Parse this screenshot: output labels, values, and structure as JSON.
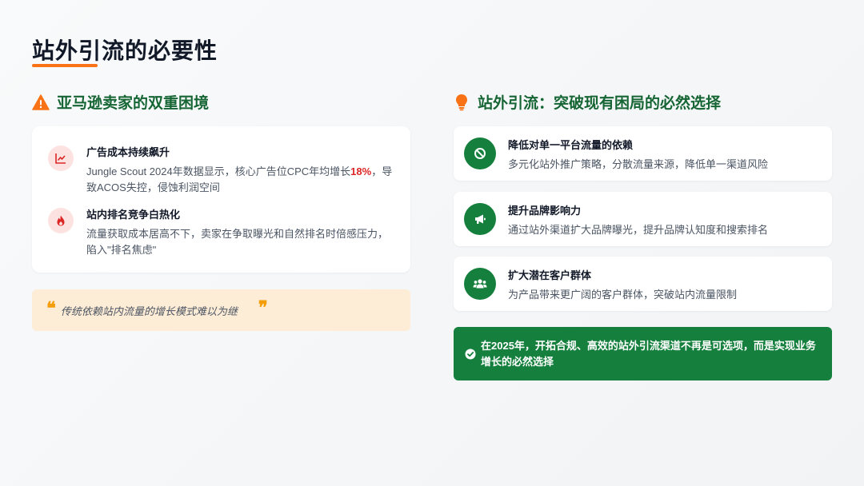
{
  "page": {
    "title": "站外引流的必要性"
  },
  "left": {
    "heading": "亚马逊卖家的双重困境",
    "heading_icon": "warning-icon",
    "items": [
      {
        "icon": "trend-chart-icon",
        "title": "广告成本持续飙升",
        "desc_before": "Jungle Scout 2024年数据显示，核心广告位CPC年均增长",
        "desc_highlight": "18%",
        "desc_after": "，导致ACOS失控，侵蚀利润空间"
      },
      {
        "icon": "fire-icon",
        "title": "站内排名竞争白热化",
        "desc": "流量获取成本居高不下，卖家在争取曝光和自然排名时倍感压力，陷入\"排名焦虑\""
      }
    ],
    "quote": {
      "open_mark": "❝",
      "text": "传统依赖站内流量的增长模式难以为继",
      "close_mark": "❞"
    }
  },
  "right": {
    "heading": "站外引流：突破现有困局的必然选择",
    "heading_icon": "lightbulb-icon",
    "items": [
      {
        "icon": "ban-icon",
        "title": "降低对单一平台流量的依赖",
        "desc": "多元化站外推广策略，分散流量来源，降低单一渠道风险"
      },
      {
        "icon": "megaphone-icon",
        "title": "提升品牌影响力",
        "desc": "通过站外渠道扩大品牌曝光，提升品牌认知度和搜索排名"
      },
      {
        "icon": "users-icon",
        "title": "扩大潜在客户群体",
        "desc": "为产品带来更广阔的客户群体，突破站内流量限制"
      }
    ],
    "conclusion": {
      "icon": "check-circle-icon",
      "text": "在2025年，开拓合规、高效的站外引流渠道不再是可选项，而是实现业务增长的必然选择"
    }
  },
  "colors": {
    "accent_orange": "#f97316",
    "brand_green": "#15803d",
    "heading_green": "#166534",
    "highlight_red": "#dc2626",
    "quote_bg": "#fdecd6"
  }
}
